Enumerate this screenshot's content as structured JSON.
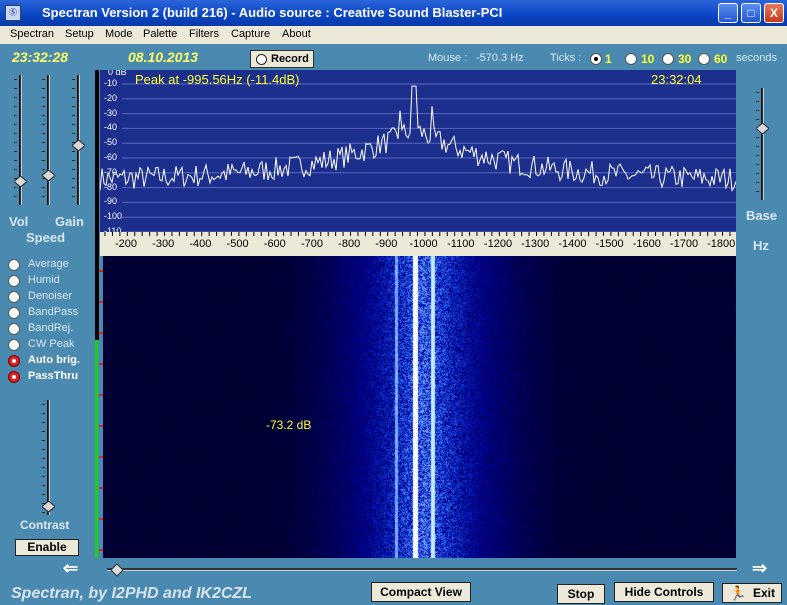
{
  "window": {
    "title": "Spectran Version 2 (build 216) - Audio source  :  Creative Sound Blaster-PCI",
    "icon": "app-icon",
    "min_glyph": "_",
    "max_glyph": "□",
    "close_glyph": "X"
  },
  "menu": [
    "Spectran",
    "Setup",
    "Mode",
    "Palette",
    "Filters",
    "Capture",
    "About"
  ],
  "toolbar": {
    "time": "23:32:28",
    "date": "08.10.2013",
    "record_label": "Record",
    "mouse_label": "Mouse :",
    "mouse_value": "-570.3 Hz",
    "ticks_label": "Ticks :",
    "ticks_options": [
      "1",
      "10",
      "30",
      "60"
    ],
    "ticks_selected": "1",
    "seconds_label": "seconds"
  },
  "left_panel": {
    "vol_label": "Vol",
    "gain_label": "Gain",
    "speed_label": "Speed",
    "vol_level": 0.85,
    "gain_level": 0.55,
    "speed_level": 0.8,
    "options": [
      {
        "label": "Average",
        "active": false
      },
      {
        "label": "Humid",
        "active": false
      },
      {
        "label": "Denoiser",
        "active": false
      },
      {
        "label": "BandPass",
        "active": false
      },
      {
        "label": "BandRej.",
        "active": false
      },
      {
        "label": "CW Peak",
        "active": false
      },
      {
        "label": "Auto brig.",
        "active": true
      },
      {
        "label": "PassThru",
        "active": true
      }
    ],
    "contrast_label": "Contrast",
    "contrast_level": 0.97,
    "enable_label": "Enable"
  },
  "right_panel": {
    "base_label": "Base",
    "hz_label": "Hz",
    "base_level": 0.35
  },
  "spectrum": {
    "peak_text": "Peak at  -995.56Hz (-11.4dB)",
    "time": "23:32:04",
    "db_top_label": "0 dB",
    "db_labels": [
      "-10",
      "-20",
      "-30",
      "-40",
      "-50",
      "-60",
      "-70",
      "-80",
      "-90",
      "-100",
      "-110"
    ],
    "freq_labels": [
      "-200",
      "-300",
      "-400",
      "-500",
      "-600",
      "-700",
      "-800",
      "-900",
      "-1000",
      "-1100",
      "-1200",
      "-1300",
      "-1400",
      "-1500",
      "-1600",
      "-1700",
      "-1800"
    ]
  },
  "waterfall": {
    "cursor_db": "-73.2 dB"
  },
  "buttons": {
    "compact_view": "Compact View",
    "stop": "Stop",
    "hide_controls": "Hide Controls",
    "exit": "Exit"
  },
  "footer": "Spectran, by I2PHD and IK2CZL",
  "colors": {
    "panel_bg": "#4a8ab0",
    "spectrum_bg": "#1c2f8c",
    "yellow_text": "#ffff33",
    "waterfall_bg": "#00003a"
  }
}
